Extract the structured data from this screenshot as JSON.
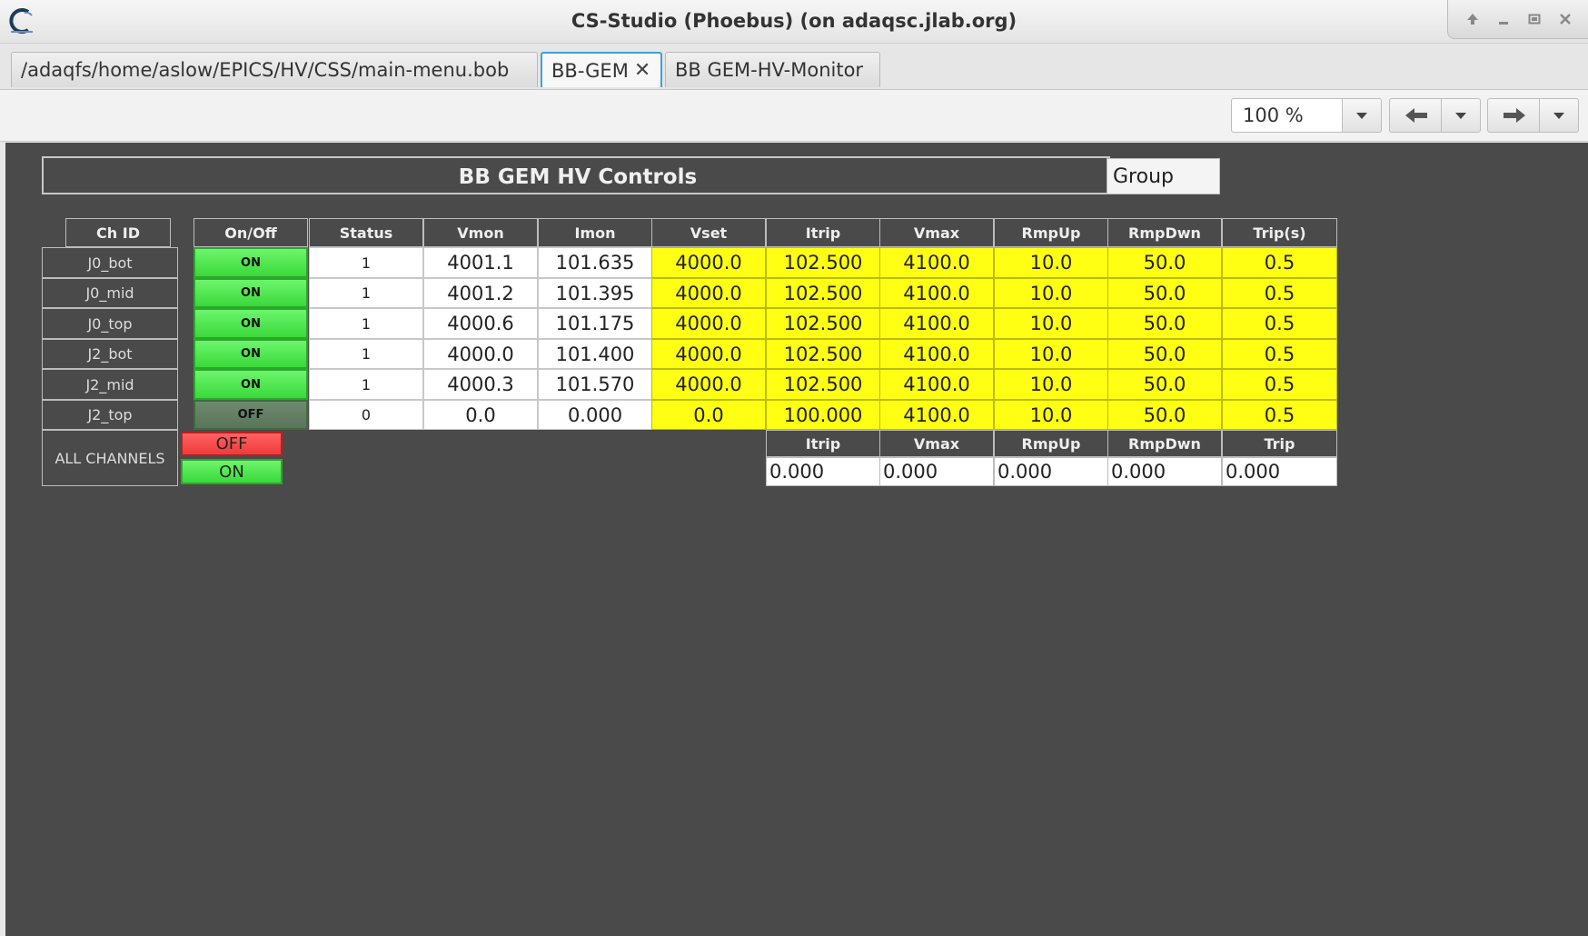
{
  "window": {
    "title": "CS-Studio (Phoebus) (on adaqsc.jlab.org)",
    "controls": [
      "up-icon",
      "minimize-icon",
      "maximize-icon",
      "close-icon"
    ]
  },
  "tabs": [
    {
      "label": "/adaqfs/home/aslow/EPICS/HV/CSS/main-menu.bob",
      "active": false
    },
    {
      "label": "BB-GEM",
      "active": true,
      "close": "✕"
    },
    {
      "label": "BB GEM-HV-Monitor",
      "active": false
    }
  ],
  "toolbar": {
    "zoom": "100 %"
  },
  "display": {
    "title": "BB GEM HV Controls",
    "group_value": "Group",
    "columns": [
      "Ch ID",
      "On/Off",
      "Status",
      "Vmon",
      "Imon",
      "Vset",
      "Itrip",
      "Vmax",
      "RmpUp",
      "RmpDwn",
      "Trip(s)"
    ],
    "rows": [
      {
        "id": "J0_bot",
        "onoff": "ON",
        "status": "1",
        "vmon": "4001.1",
        "imon": "101.635",
        "vset": "4000.0",
        "itrip": "102.500",
        "vmax": "4100.0",
        "rmpup": "10.0",
        "rmpdwn": "50.0",
        "trip": "0.5"
      },
      {
        "id": "J0_mid",
        "onoff": "ON",
        "status": "1",
        "vmon": "4001.2",
        "imon": "101.395",
        "vset": "4000.0",
        "itrip": "102.500",
        "vmax": "4100.0",
        "rmpup": "10.0",
        "rmpdwn": "50.0",
        "trip": "0.5"
      },
      {
        "id": "J0_top",
        "onoff": "ON",
        "status": "1",
        "vmon": "4000.6",
        "imon": "101.175",
        "vset": "4000.0",
        "itrip": "102.500",
        "vmax": "4100.0",
        "rmpup": "10.0",
        "rmpdwn": "50.0",
        "trip": "0.5"
      },
      {
        "id": "J2_bot",
        "onoff": "ON",
        "status": "1",
        "vmon": "4000.0",
        "imon": "101.400",
        "vset": "4000.0",
        "itrip": "102.500",
        "vmax": "4100.0",
        "rmpup": "10.0",
        "rmpdwn": "50.0",
        "trip": "0.5"
      },
      {
        "id": "J2_mid",
        "onoff": "ON",
        "status": "1",
        "vmon": "4000.3",
        "imon": "101.570",
        "vset": "4000.0",
        "itrip": "102.500",
        "vmax": "4100.0",
        "rmpup": "10.0",
        "rmpdwn": "50.0",
        "trip": "0.5"
      },
      {
        "id": "J2_top",
        "onoff": "OFF",
        "status": "0",
        "vmon": "0.0",
        "imon": "0.000",
        "vset": "0.0",
        "itrip": "100.000",
        "vmax": "4100.0",
        "rmpup": "10.0",
        "rmpdwn": "50.0",
        "trip": "0.5"
      }
    ],
    "all_channels": {
      "label": "ALL CHANNELS",
      "off_label": "OFF",
      "on_label": "ON",
      "columns": [
        "Itrip",
        "Vmax",
        "RmpUp",
        "RmpDwn",
        "Trip"
      ],
      "values": [
        "0.000",
        "0.000",
        "0.000",
        "0.000",
        "0.000"
      ]
    }
  }
}
